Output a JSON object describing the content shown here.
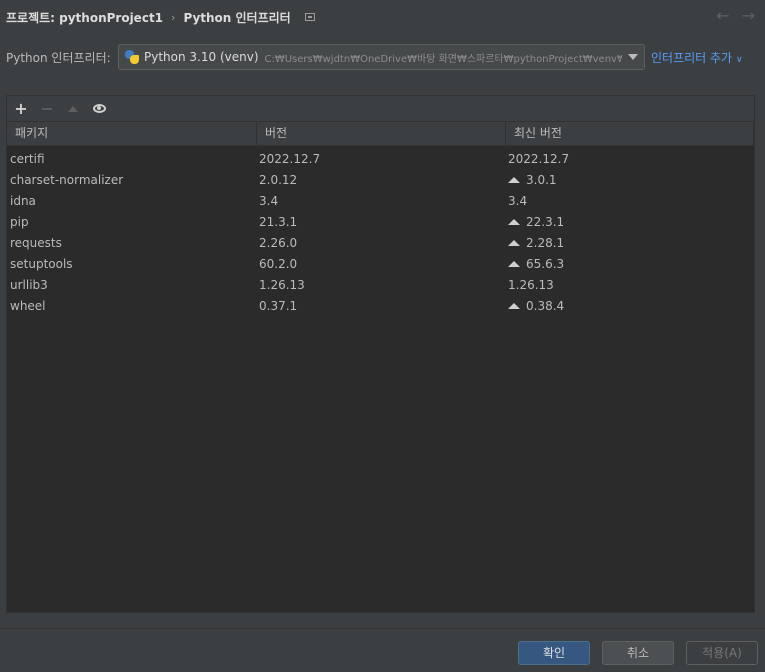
{
  "breadcrumb": {
    "project": "프로젝트: pythonProject1",
    "page": "Python 인터프리터"
  },
  "interpreter": {
    "label": "Python 인터프리터:",
    "name": "Python 3.10 (venv)",
    "path": "C:₩Users₩wjdtn₩OneDrive₩바탕 화면₩스파르타₩pythonProject₩venv₩Sc",
    "add_label": "인터프리터 추가"
  },
  "table": {
    "headers": [
      "패키지",
      "버전",
      "최신 버전"
    ],
    "rows": [
      {
        "package": "certifi",
        "version": "2022.12.7",
        "latest": "2022.12.7",
        "upgrade": false
      },
      {
        "package": "charset-normalizer",
        "version": "2.0.12",
        "latest": "3.0.1",
        "upgrade": true
      },
      {
        "package": "idna",
        "version": "3.4",
        "latest": "3.4",
        "upgrade": false
      },
      {
        "package": "pip",
        "version": "21.3.1",
        "latest": "22.3.1",
        "upgrade": true
      },
      {
        "package": "requests",
        "version": "2.26.0",
        "latest": "2.28.1",
        "upgrade": true
      },
      {
        "package": "setuptools",
        "version": "60.2.0",
        "latest": "65.6.3",
        "upgrade": true
      },
      {
        "package": "urllib3",
        "version": "1.26.13",
        "latest": "1.26.13",
        "upgrade": false
      },
      {
        "package": "wheel",
        "version": "0.37.1",
        "latest": "0.38.4",
        "upgrade": true
      }
    ]
  },
  "toolbar": {
    "add_icon": "plus-icon",
    "remove_icon": "minus-icon",
    "upgrade_icon": "arrow-up-icon",
    "show_icon": "eye-icon"
  },
  "buttons": {
    "ok": "확인",
    "cancel": "취소",
    "apply": "적용(A)"
  },
  "colors": {
    "background": "#3c3f41",
    "table_bg": "#2b2b2b",
    "accent": "#589df6",
    "ok_button": "#365880"
  }
}
